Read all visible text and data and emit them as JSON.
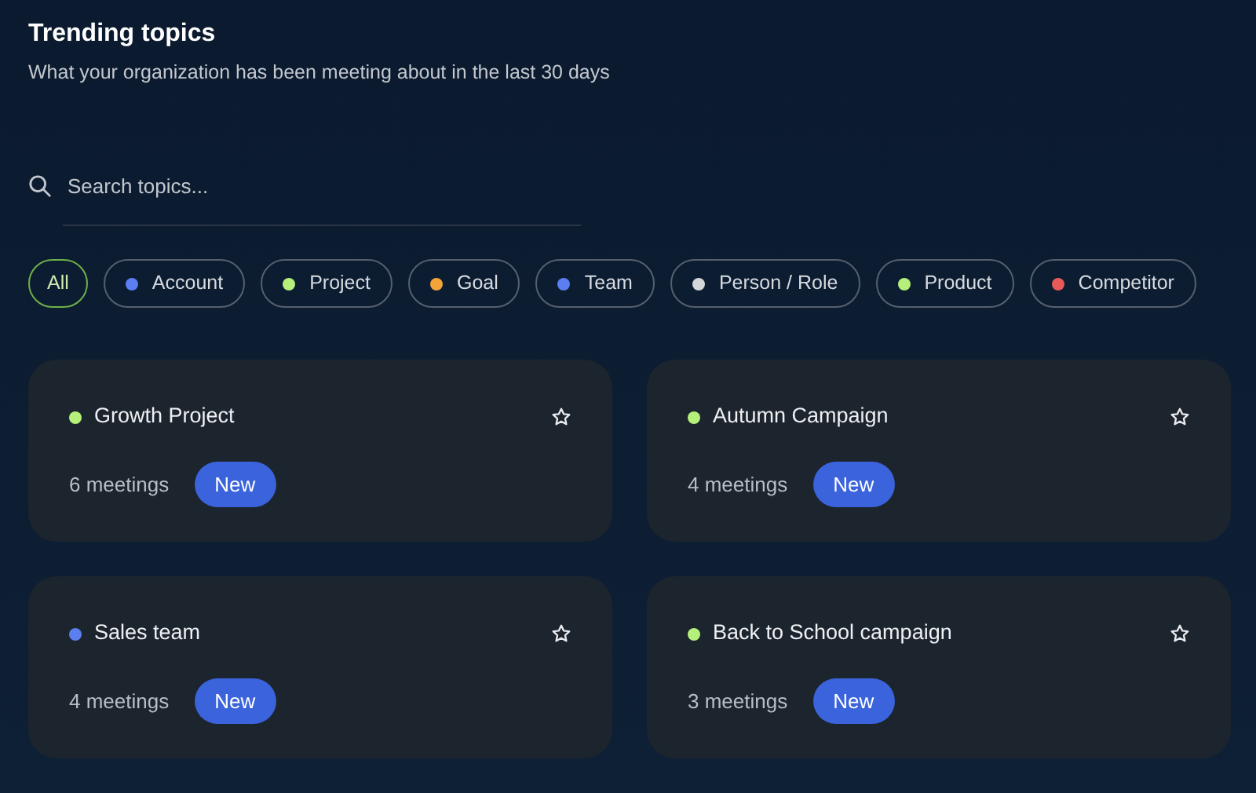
{
  "header": {
    "title": "Trending topics",
    "subtitle": "What your organization has been meeting about in the last 30 days"
  },
  "search": {
    "placeholder": "Search topics..."
  },
  "filters": [
    {
      "label": "All",
      "selected": true
    },
    {
      "label": "Account",
      "selected": false,
      "color": "#5b7ff0"
    },
    {
      "label": "Project",
      "selected": false,
      "color": "#b5f07a"
    },
    {
      "label": "Goal",
      "selected": false,
      "color": "#f2a33a"
    },
    {
      "label": "Team",
      "selected": false,
      "color": "#5b7ff0"
    },
    {
      "label": "Person / Role",
      "selected": false,
      "color": "#d4d6d9"
    },
    {
      "label": "Product",
      "selected": false,
      "color": "#b5f07a"
    },
    {
      "label": "Competitor",
      "selected": false,
      "color": "#e85a5a"
    }
  ],
  "topics": [
    {
      "name": "Growth Project",
      "color": "#b5f07a",
      "starred": false,
      "meetings": "6 meetings",
      "badge": "New"
    },
    {
      "name": "Autumn Campaign",
      "color": "#b5f07a",
      "starred": false,
      "meetings": "4 meetings",
      "badge": "New"
    },
    {
      "name": "Sales team",
      "color": "#5b7ff0",
      "starred": false,
      "meetings": "4 meetings",
      "badge": "New"
    },
    {
      "name": "Back to School campaign",
      "color": "#b5f07a",
      "starred": false,
      "meetings": "3 meetings",
      "badge": "New"
    }
  ]
}
